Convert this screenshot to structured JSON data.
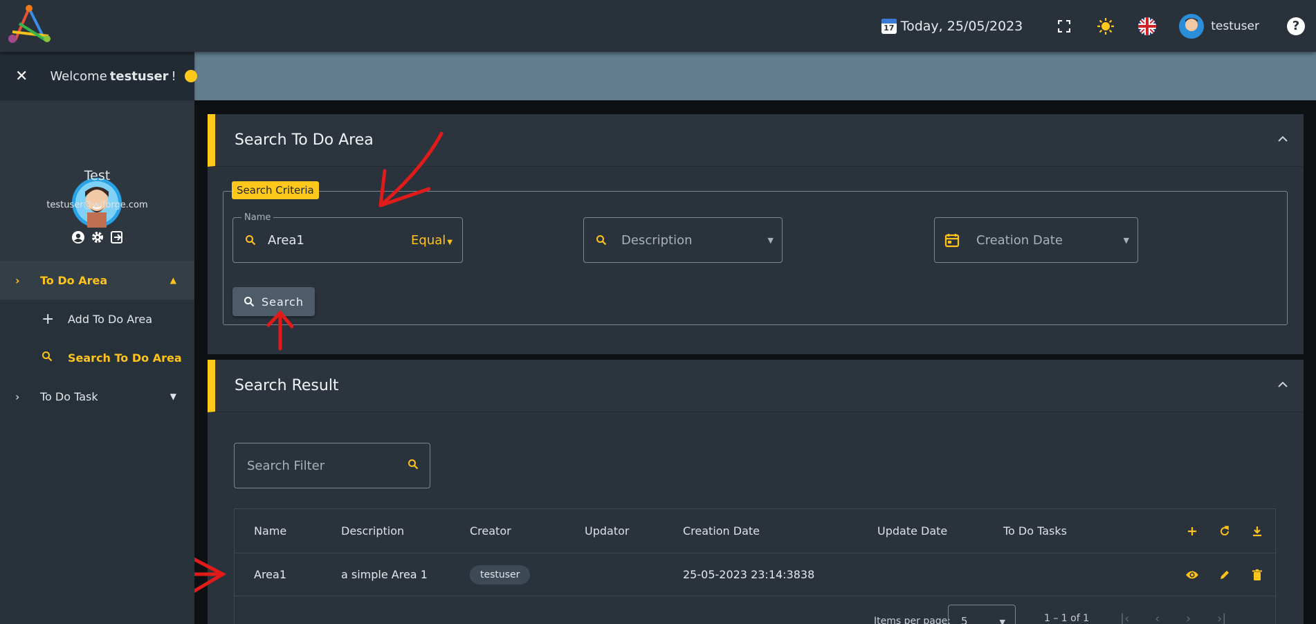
{
  "topbar": {
    "date_label": "Today, 25/05/2023",
    "calendar_day": "17",
    "username": "testuser"
  },
  "sidebar": {
    "welcome_prefix": "Welcome",
    "welcome_user": "testuser",
    "welcome_suffix": "!",
    "profile_name": "Test",
    "profile_email": "testuser@wiforge.com",
    "menu": [
      {
        "label": "To Do Area"
      },
      {
        "label": "Add To Do Area"
      },
      {
        "label": "Search To Do Area"
      },
      {
        "label": "To Do Task"
      }
    ]
  },
  "search_panel": {
    "title": "Search To Do Area",
    "legend": "Search Criteria",
    "name_label": "Name",
    "name_value": "Area1",
    "name_operator": "Equal",
    "description_placeholder": "Description",
    "creation_date_placeholder": "Creation Date",
    "search_button": "Search"
  },
  "result_panel": {
    "title": "Search Result",
    "filter_placeholder": "Search Filter",
    "columns": [
      "Name",
      "Description",
      "Creator",
      "Updator",
      "Creation Date",
      "Update Date",
      "To Do Tasks"
    ],
    "rows": [
      {
        "name": "Area1",
        "description": "a simple Area 1",
        "creator": "testuser",
        "updator": "",
        "creation_date": "25-05-2023 23:14:3838",
        "update_date": "",
        "tasks": ""
      }
    ],
    "items_per_page_label": "Items per page:",
    "items_per_page": "5",
    "range": "1 – 1 of 1"
  },
  "colors": {
    "accent": "#ffc81a",
    "annotation": "#e11a1a"
  }
}
